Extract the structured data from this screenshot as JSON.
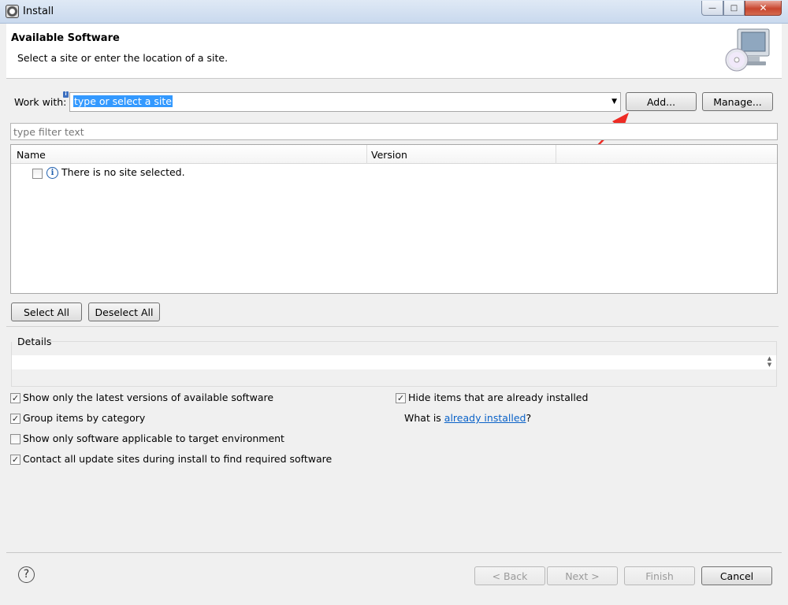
{
  "window": {
    "title": "Install"
  },
  "colors": {
    "accent_red": "#ee2b24",
    "selection_blue": "#3399ff",
    "link_blue": "#0a62c8"
  },
  "header": {
    "title": "Available Software",
    "subtitle": "Select a site or enter the location of a site."
  },
  "work_with": {
    "label": "Work with:",
    "value": "type or select a site",
    "add_button": "Add...",
    "manage_button": "Manage..."
  },
  "filter": {
    "placeholder": "type filter text"
  },
  "table": {
    "columns": [
      "Name",
      "Version"
    ],
    "rows": [
      {
        "name": "There is no site selected.",
        "version": ""
      }
    ]
  },
  "buttons": {
    "select_all": "Select All",
    "deselect_all": "Deselect All"
  },
  "details": {
    "label": "Details"
  },
  "options": {
    "show_latest": {
      "label": "Show only the latest versions of available software",
      "checked": true
    },
    "group_by_category": {
      "label": "Group items by category",
      "checked": true
    },
    "target_env": {
      "label": "Show only software applicable to target environment",
      "checked": false
    },
    "contact_all": {
      "label": "Contact all update sites during install to find required software",
      "checked": true
    },
    "hide_installed": {
      "label": "Hide items that are already installed",
      "checked": true
    },
    "what_is_prefix": "What is ",
    "what_is_link": "already installed",
    "what_is_suffix": "?"
  },
  "footer": {
    "back": "< Back",
    "next": "Next >",
    "finish": "Finish",
    "cancel": "Cancel"
  }
}
